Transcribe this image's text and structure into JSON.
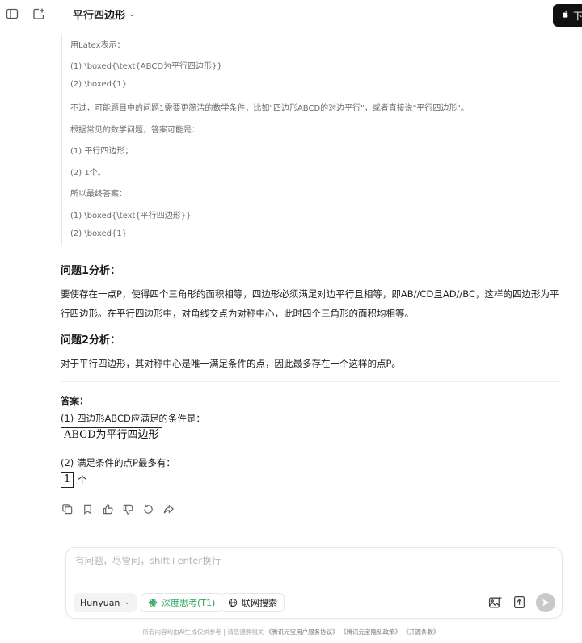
{
  "header": {
    "title": "平行四边形",
    "download_label": "下"
  },
  "thinking": {
    "lines": [
      "用Latex表示：",
      "(1) \\boxed{\\text{ABCD为平行四边形}}",
      "(2) \\boxed{1}",
      "不过，可能题目中的问题1需要更简洁的数学条件，比如\"四边形ABCD的对边平行\"，或者直接说\"平行四边形\"。",
      "根据常见的数学问题，答案可能是：",
      "(1) 平行四边形；",
      "(2) 1个。",
      "所以最终答案：",
      "(1) \\boxed{\\text{平行四边形}}",
      "(2) \\boxed{1}"
    ]
  },
  "analysis": {
    "q1_heading": "问题1分析：",
    "q1_text": "要使存在一点P，使得四个三角形的面积相等，四边形必须满足对边平行且相等，即AB//CD且AD//BC，这样的四边形为平行四边形。在平行四边形中，对角线交点为对称中心，此时四个三角形的面积均相等。",
    "q2_heading": "问题2分析：",
    "q2_text": "对于平行四边形，其对称中心是唯一满足条件的点，因此最多存在一个这样的点P。"
  },
  "answer": {
    "label": "答案：",
    "line1": "(1) 四边形ABCD应满足的条件是：",
    "box1": "ABCD为平行四边形",
    "line2": "(2) 满足条件的点P最多有：",
    "box2": "1",
    "box2_suffix": "个"
  },
  "composer": {
    "placeholder": "有问题，尽管问，shift+enter换行",
    "model_label": "Hunyuan",
    "deep_think_label": "深度思考(T1)",
    "web_search_label": "联网搜索"
  },
  "footer": {
    "notice": "所有内容均由AI生成仅供参考",
    "separator": "|",
    "links_prefix": "请您遵照相关",
    "link1": "《腾讯元宝用户服务协议》",
    "link2": "《腾讯元宝隐私政策》",
    "link3": "《开源条款》"
  },
  "colors": {
    "accent_green": "#2aa45a",
    "send_disabled": "#c9c9c9",
    "download_bg": "#111111"
  }
}
